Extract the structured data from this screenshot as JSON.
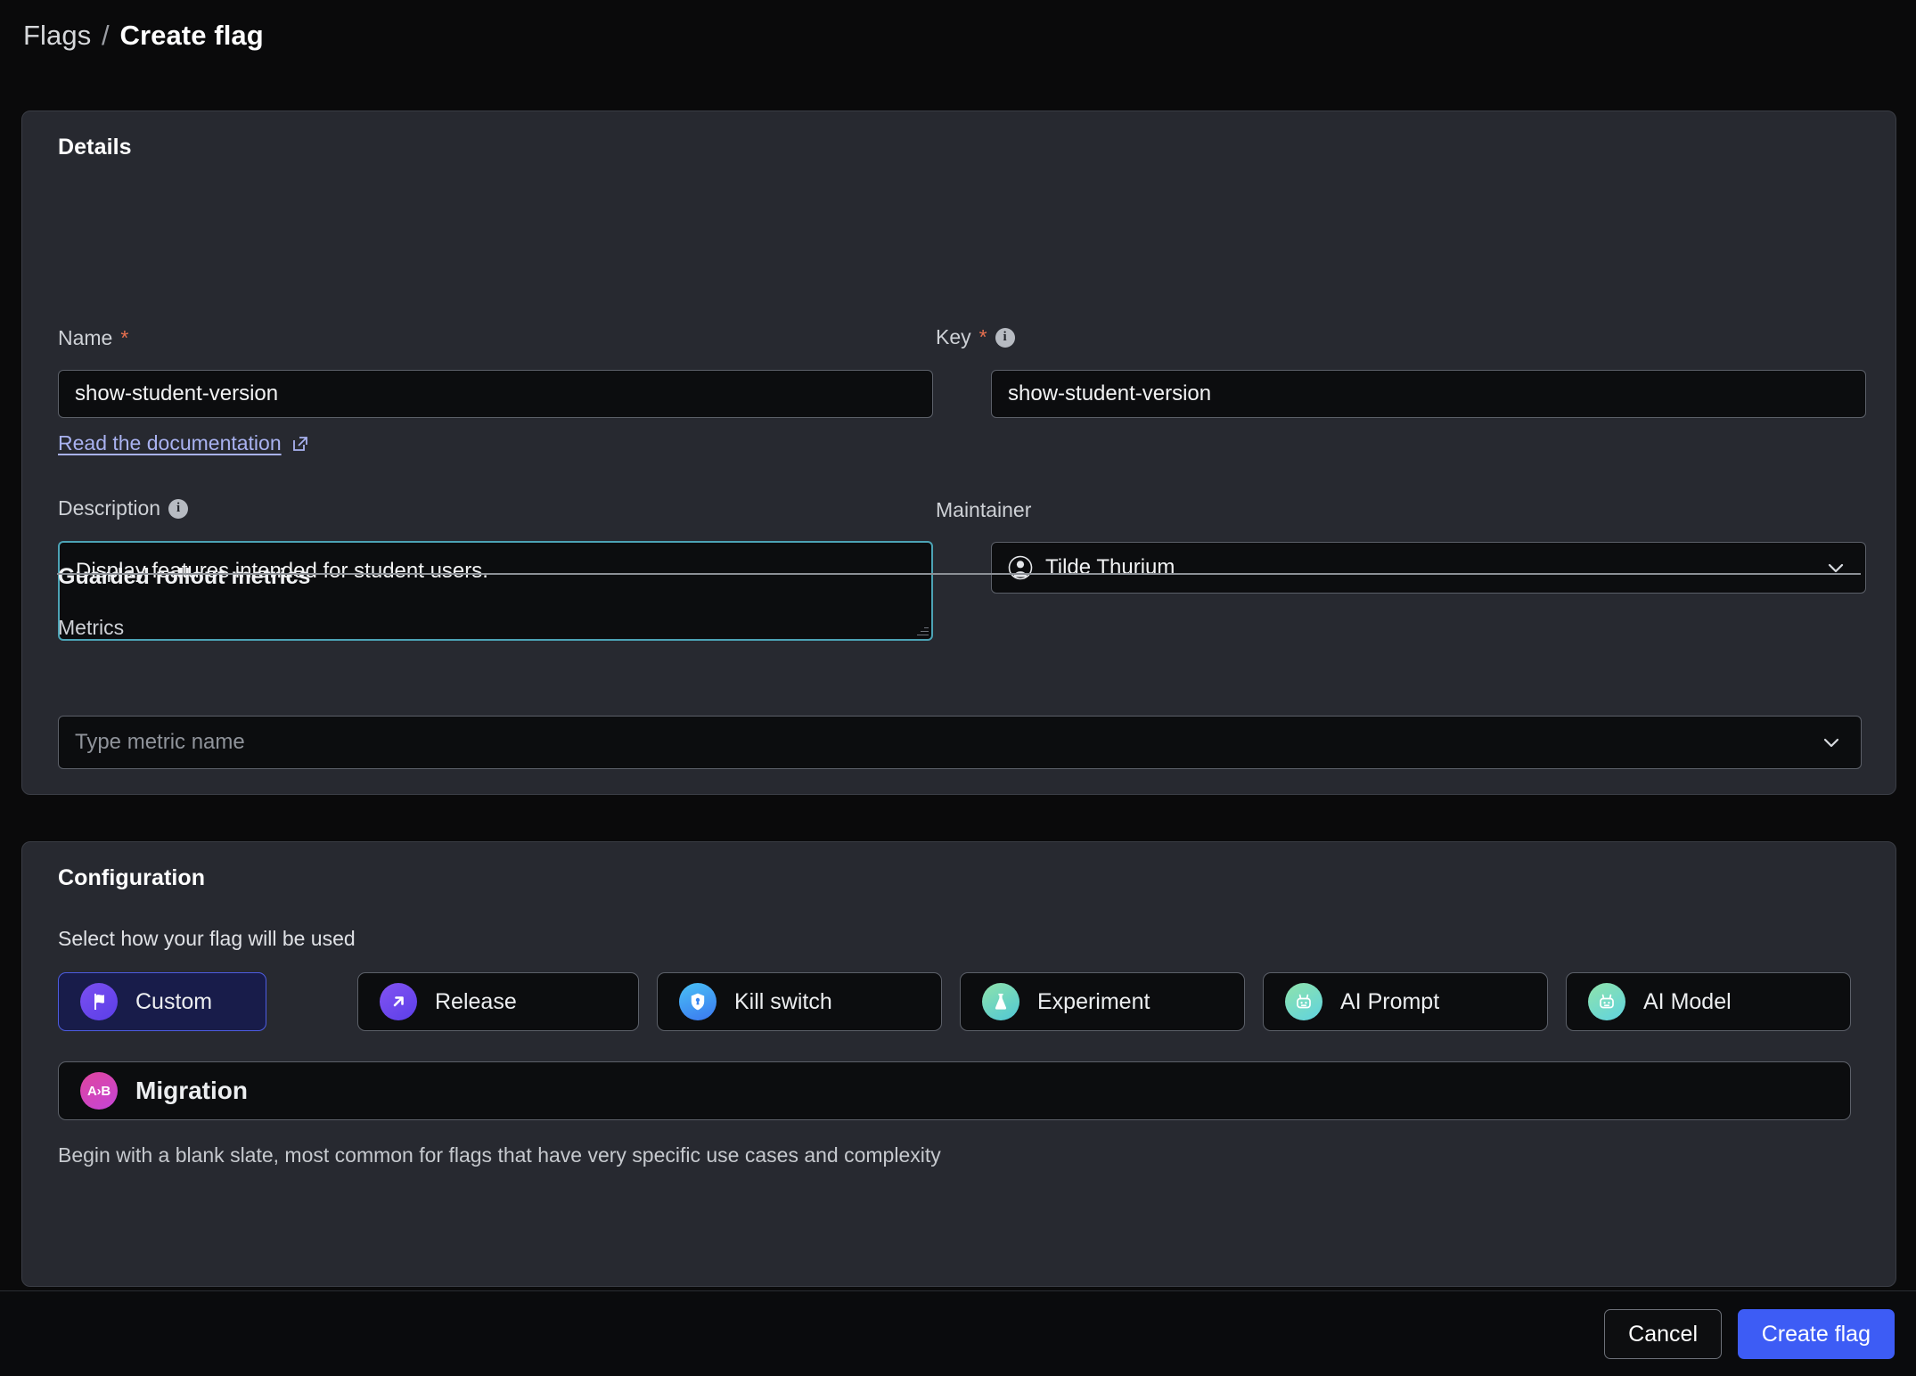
{
  "breadcrumb": {
    "parent": "Flags",
    "separator": "/",
    "current": "Create flag"
  },
  "details": {
    "title": "Details",
    "name": {
      "label": "Name",
      "required_marker": "*",
      "value": "show-student-version",
      "placeholder": ""
    },
    "key": {
      "label": "Key",
      "required_marker": "*",
      "info_icon": "info-icon",
      "value": "show-student-version",
      "placeholder": ""
    },
    "doc_link": {
      "label": "Read the documentation",
      "icon": "external-link-icon"
    },
    "description": {
      "label": "Description",
      "info_icon": "info-icon",
      "value": "Display features intended for student users.",
      "placeholder": ""
    },
    "maintainer": {
      "label": "Maintainer",
      "selected": "Tilde Thurium",
      "avatar_icon": "user-avatar-icon",
      "chevron": "chevron-down-icon"
    },
    "guarded_rollout": {
      "title": "Guarded rollout metrics",
      "metrics": {
        "label": "Metrics",
        "value": "",
        "placeholder": "Type metric name",
        "chevron": "chevron-down-icon"
      }
    }
  },
  "configuration": {
    "title": "Configuration",
    "prompt": "Select how your flag will be used",
    "types": [
      {
        "label": "Custom",
        "icon": "flag-icon",
        "selected": true,
        "glyph_class": "g-custom"
      },
      {
        "label": "Release",
        "icon": "arrow-up-right-icon",
        "selected": false,
        "glyph_class": "g-release"
      },
      {
        "label": "Kill switch",
        "icon": "shield-lock-icon",
        "selected": false,
        "glyph_class": "g-killswitch"
      },
      {
        "label": "Experiment",
        "icon": "flask-icon",
        "selected": false,
        "glyph_class": "g-experiment"
      },
      {
        "label": "AI Prompt",
        "icon": "robot-icon",
        "selected": false,
        "glyph_class": "g-ai"
      },
      {
        "label": "AI Model",
        "icon": "robot-icon",
        "selected": false,
        "glyph_class": "g-ai"
      },
      {
        "label": "Migration",
        "icon": "a-to-b-icon",
        "selected": false,
        "glyph_class": "g-migration",
        "badge_text": "A›B"
      }
    ],
    "description": "Begin with a blank slate, most common for flags that have very specific use cases and complexity"
  },
  "footer": {
    "cancel_label": "Cancel",
    "create_label": "Create flag"
  },
  "colors": {
    "page_background": "#0a0a0b",
    "card_background": "#272930",
    "input_background": "#0c0d0f",
    "accent_primary": "#3d5cf5",
    "focus_border": "#4ca3b5",
    "selected_chip_background": "#181c4a",
    "selected_chip_border": "#4d5ce0",
    "link": "#a9b2f0",
    "required_star": "#e8704f"
  }
}
